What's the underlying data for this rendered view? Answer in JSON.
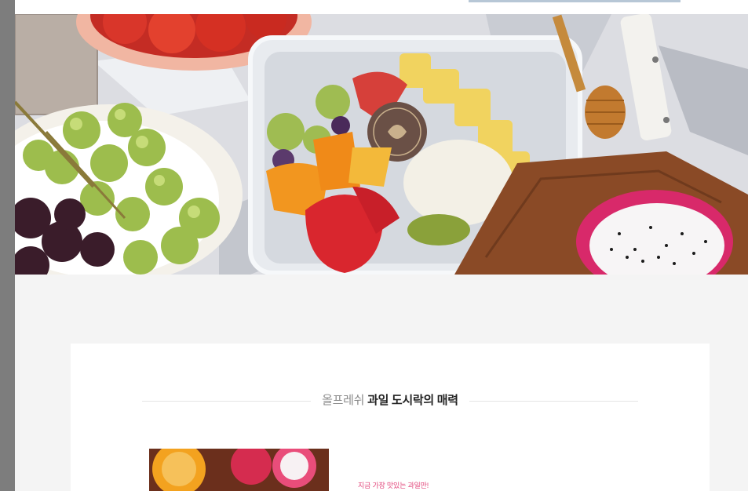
{
  "page": {
    "background": "#f4f4f4",
    "accent_pink": "#e2457a"
  },
  "hero": {
    "alt": "fruit lunch box banner",
    "badge_icon": "fruit-brand-badge"
  },
  "intro": {
    "title_light": "올프레쉬",
    "title_bold": "과일 도시락의 매력"
  },
  "feature": {
    "tagline": "지금 가장 맛있는 과일만!"
  }
}
